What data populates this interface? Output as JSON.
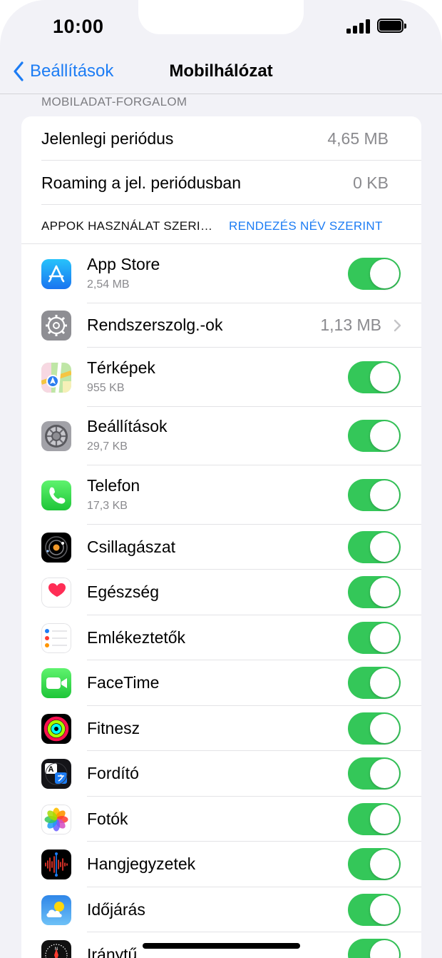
{
  "status_bar": {
    "time": "10:00"
  },
  "nav": {
    "back_label": "Beállítások",
    "title": "Mobilhálózat"
  },
  "section": {
    "header": "MOBILADAT-FORGALOM"
  },
  "usage": {
    "current_period_label": "Jelenlegi periódus",
    "current_period_value": "4,65 MB",
    "roaming_label": "Roaming a jel. periódusban",
    "roaming_value": "0 KB"
  },
  "apps_header": {
    "label": "APPOK HASZNÁLAT SZERI…",
    "sort": "RENDEZÉS NÉV SZERINT"
  },
  "apps": [
    {
      "name": "App Store",
      "size": "2,54 MB",
      "icon": "app-store-icon",
      "toggle": true
    },
    {
      "name": "Rendszerszolg.-ok",
      "detail": "1,13 MB",
      "icon": "system-services-icon",
      "chevron": true
    },
    {
      "name": "Térképek",
      "size": "955 KB",
      "icon": "maps-icon",
      "toggle": true
    },
    {
      "name": "Beállítások",
      "size": "29,7 KB",
      "icon": "settings-icon",
      "toggle": true
    },
    {
      "name": "Telefon",
      "size": "17,3 KB",
      "icon": "phone-icon",
      "toggle": true
    },
    {
      "name": "Csillagászat",
      "icon": "astronomy-icon",
      "toggle": true
    },
    {
      "name": "Egészség",
      "icon": "health-icon",
      "toggle": true
    },
    {
      "name": "Emlékeztetők",
      "icon": "reminders-icon",
      "toggle": true
    },
    {
      "name": "FaceTime",
      "icon": "facetime-icon",
      "toggle": true
    },
    {
      "name": "Fitnesz",
      "icon": "fitness-icon",
      "toggle": true
    },
    {
      "name": "Fordító",
      "icon": "translate-icon",
      "toggle": true
    },
    {
      "name": "Fotók",
      "icon": "photos-icon",
      "toggle": true
    },
    {
      "name": "Hangjegyzetek",
      "icon": "voice-memos-icon",
      "toggle": true
    },
    {
      "name": "Időjárás",
      "icon": "weather-icon",
      "toggle": true
    },
    {
      "name": "Iránytű",
      "icon": "compass-icon",
      "toggle": true
    }
  ],
  "colors": {
    "accent": "#1c7cf4",
    "toggle_on": "#34c759",
    "background": "#f2f2f7"
  }
}
